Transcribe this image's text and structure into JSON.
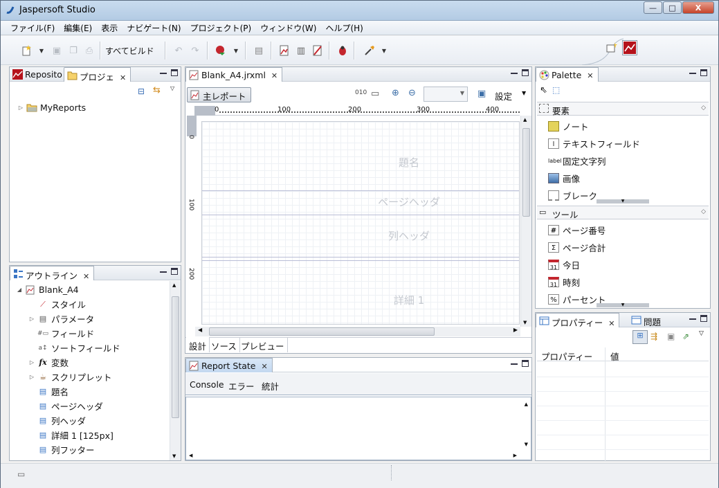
{
  "window": {
    "title": "Jaspersoft Studio",
    "buttons": [
      "—",
      "□",
      "X"
    ]
  },
  "menu": [
    "ファイル(F)",
    "編集(E)",
    "表示",
    "ナビゲート(N)",
    "プロジェクト(P)",
    "ウィンドウ(W)",
    "ヘルプ(H)"
  ],
  "toolbar": {
    "build_all_label": "すべてビルド"
  },
  "repository_panel": {
    "tabs": [
      "Reposito",
      "プロジェ"
    ],
    "tree": [
      {
        "label": "MyReports"
      }
    ]
  },
  "outline_panel": {
    "tab": "アウトライン",
    "items": [
      {
        "label": "Blank_A4",
        "icon": "report-icon",
        "expanded": true
      },
      {
        "label": "スタイル",
        "icon": "style-icon"
      },
      {
        "label": "パラメータ",
        "icon": "parameter-icon",
        "expandable": true
      },
      {
        "label": "フィールド",
        "icon": "field-icon"
      },
      {
        "label": "ソートフィールド",
        "icon": "sortfield-icon"
      },
      {
        "label": "変数",
        "icon": "variable-icon",
        "expandable": true
      },
      {
        "label": "スクリプレット",
        "icon": "scriptlet-icon",
        "expandable": true
      },
      {
        "label": "題名",
        "icon": "band-icon"
      },
      {
        "label": "ページヘッダ",
        "icon": "band-icon"
      },
      {
        "label": "列ヘッダ",
        "icon": "band-icon"
      },
      {
        "label": "詳細 1 [125px]",
        "icon": "band-icon"
      },
      {
        "label": "列フッター",
        "icon": "band-icon"
      }
    ]
  },
  "editor": {
    "tab": "Blank_A4.jrxml",
    "main_report_button": "主レポート",
    "settings_label": "設定",
    "ruler_labels": [
      "0",
      "100",
      "200",
      "300",
      "400"
    ],
    "vruler_labels": [
      "0",
      "100",
      "200"
    ],
    "bands": [
      "題名",
      "ページヘッダ",
      "列ヘッダ",
      "詳細 1"
    ],
    "bottom_tabs": [
      "設計",
      "ソース",
      "プレビュー"
    ]
  },
  "report_state": {
    "tab": "Report State",
    "subtabs": [
      "Console",
      "エラー",
      "統計"
    ]
  },
  "palette": {
    "tab": "Palette",
    "elements_header": "要素",
    "elements": [
      {
        "label": "ノート",
        "icon": "note-icon"
      },
      {
        "label": "テキストフィールド",
        "icon": "textfield-icon"
      },
      {
        "label": "固定文字列",
        "icon": "label-icon"
      },
      {
        "label": "画像",
        "icon": "image-icon"
      },
      {
        "label": "ブレーク",
        "icon": "break-icon"
      }
    ],
    "tools_header": "ツール",
    "tools": [
      {
        "label": "ページ番号",
        "icon": "hash-icon"
      },
      {
        "label": "ページ合計",
        "icon": "sigma-icon"
      },
      {
        "label": "今日",
        "icon": "calendar-icon"
      },
      {
        "label": "時刻",
        "icon": "calendar-icon"
      },
      {
        "label": "パーセント",
        "icon": "percent-icon"
      }
    ]
  },
  "properties_panel": {
    "tabs": [
      "プロパティー",
      "問題"
    ],
    "columns": [
      "プロパティー",
      "値"
    ]
  },
  "icon_glyphs": {
    "label_icon": "label"
  }
}
